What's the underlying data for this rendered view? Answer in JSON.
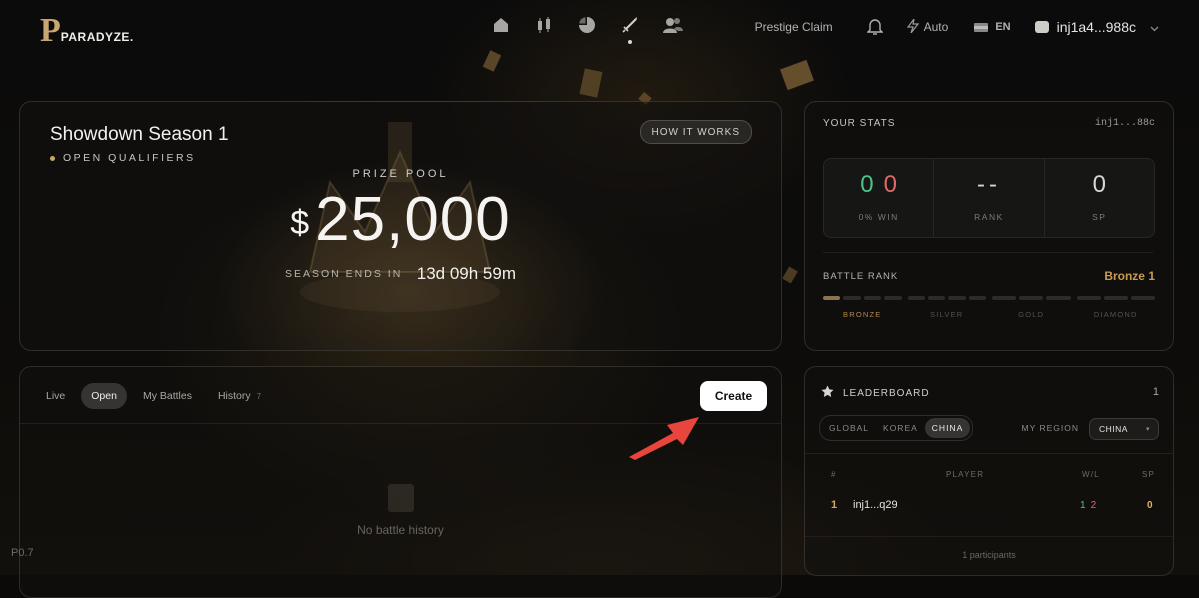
{
  "app": {
    "logo_mark": "P",
    "logo_text": "PARADYZE."
  },
  "nav": {
    "icons": [
      "home-icon",
      "chart-candles-icon",
      "pie-chart-icon",
      "sword-icon",
      "users-icon"
    ],
    "prestige_label": "Prestige Claim",
    "auto_label": "Auto",
    "language": "EN",
    "wallet": "inj1a4...988c"
  },
  "hero": {
    "title": "Showdown Season 1",
    "subtitle": "OPEN QUALIFIERS",
    "how_button": "HOW IT WORKS",
    "prize_label": "PRIZE POOL",
    "currency": "$",
    "amount": "25,000",
    "ends_label": "SEASON ENDS IN",
    "ends_value": "13d 09h 59m"
  },
  "stats": {
    "title": "YOUR STATS",
    "address": "inj1...88c",
    "wins": "0",
    "losses": "0",
    "win_label": "0% WIN",
    "rank_value": "--",
    "rank_label": "RANK",
    "sp_value": "0",
    "sp_label": "SP",
    "battle_rank_label": "BATTLE RANK",
    "battle_rank_value": "Bronze 1",
    "tiers": [
      "BRONZE",
      "SILVER",
      "GOLD",
      "DIAMOND"
    ],
    "colors": {
      "win": "#4cc38a",
      "loss": "#e06868",
      "rank": "#c99b52"
    }
  },
  "battles": {
    "tabs": [
      {
        "label": "Live"
      },
      {
        "label": "Open"
      },
      {
        "label": "My Battles"
      },
      {
        "label": "History",
        "count": "7"
      }
    ],
    "create_label": "Create",
    "empty_text": "No battle history"
  },
  "leaderboard": {
    "title": "LEADERBOARD",
    "count": "1",
    "regions": [
      "GLOBAL",
      "KOREA",
      "CHINA"
    ],
    "my_region_label": "MY REGION",
    "my_region_value": "CHINA",
    "columns": {
      "rank": "#",
      "player": "PLAYER",
      "wl": "W/L",
      "sp": "SP"
    },
    "rows": [
      {
        "rank": "1",
        "player": "inj1...q29",
        "w": "1",
        "l": "2",
        "sp": "0"
      }
    ],
    "footer": "1 participants"
  },
  "version": "P0.7"
}
